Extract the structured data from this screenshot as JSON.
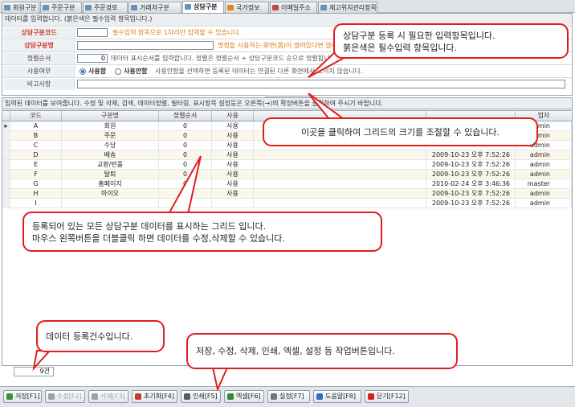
{
  "tabs": [
    {
      "label": "회원구분",
      "active": false
    },
    {
      "label": "주문구분",
      "active": false
    },
    {
      "label": "주문경로",
      "active": false
    },
    {
      "label": "거래처구분",
      "active": false
    },
    {
      "label": "상담구분",
      "active": true
    },
    {
      "label": "국가정보",
      "active": false
    },
    {
      "label": "이메일주소",
      "active": false
    },
    {
      "label": "재고위치관리항목",
      "active": false
    }
  ],
  "form": {
    "header": "데이터를 입력합니다. (붉은색은 필수입력 항목입니다.)",
    "code_label": "상담구분코드",
    "code_hint": "필수입력 항목으로 1자리만 입력할 수 있습니다.",
    "name_label": "상담구분명",
    "name_hint": "명청을 사용하는 화면(폼)이 열려있다면 열려있는 화면을 다시",
    "sort_label": "정렬순서",
    "sort_value": "0",
    "sort_hint": "데이터 표시순서를 입력합니다. 정렬은 정렬순서 + 상담구분코드 순으로 정렬됩니다.",
    "use_label": "사용여부",
    "use_yes": "사용함",
    "use_no": "사용안함",
    "use_hint": "사용안함을 선택하면 등록된 데이터는 연결된 다른 화면에서 보이지 않습니다.",
    "note_label": "비고사항"
  },
  "grid": {
    "info": "입력된 데이터를 보여줍니다. 수정 및 삭제, 검색, 데이터정렬, 필터링, 표시항목 설정등은 오른쪽(→)의 확장버튼을 클릭하여 주시기 바랍니다.",
    "columns": [
      "코드",
      "구분명",
      "정렬순서",
      "사용",
      "",
      "",
      "업자"
    ],
    "rows": [
      {
        "code": "A",
        "name": "회원",
        "sort": "0",
        "use": "사용",
        "date": "",
        "user": "admin"
      },
      {
        "code": "B",
        "name": "주문",
        "sort": "0",
        "use": "사용",
        "date": "",
        "user": "admin"
      },
      {
        "code": "C",
        "name": "수당",
        "sort": "0",
        "use": "사용",
        "date": "",
        "user": "admin"
      },
      {
        "code": "D",
        "name": "배송",
        "sort": "0",
        "use": "사용",
        "date": "2009-10-23 오후 7:52:26",
        "user": "admin"
      },
      {
        "code": "E",
        "name": "교환/반품",
        "sort": "0",
        "use": "사용",
        "date": "2009-10-23 오후 7:52:26",
        "user": "admin"
      },
      {
        "code": "F",
        "name": "탈퇴",
        "sort": "0",
        "use": "사용",
        "date": "2009-10-23 오후 7:52:26",
        "user": "admin"
      },
      {
        "code": "G",
        "name": "홈페이지",
        "sort": "0",
        "use": "사용",
        "date": "2010-02-24 오후 3:46:36",
        "user": "master"
      },
      {
        "code": "H",
        "name": "마이오",
        "sort": "0",
        "use": "사용",
        "date": "2009-10-23 오후 7:52:26",
        "user": "admin"
      },
      {
        "code": "I",
        "name": "",
        "sort": "",
        "use": "",
        "date": "2009-10-23 오후 7:52:26",
        "user": "admin"
      }
    ]
  },
  "count": "9건",
  "toolbar": [
    {
      "label": "저장[F1]",
      "icon": "save-icon",
      "disabled": false,
      "color": "#3f8f3f"
    },
    {
      "label": "수정[F2]",
      "icon": "edit-icon",
      "disabled": true,
      "color": "#9aa3ac"
    },
    {
      "label": "삭제[F3]",
      "icon": "delete-icon",
      "disabled": true,
      "color": "#9aa3ac"
    },
    {
      "label": "초기화[F4]",
      "icon": "reset-icon",
      "disabled": false,
      "color": "#c33b2a"
    },
    {
      "label": "인쇄[F5]",
      "icon": "print-icon",
      "disabled": false,
      "color": "#555f69"
    },
    {
      "label": "엑셀[F6]",
      "icon": "excel-icon",
      "disabled": false,
      "color": "#2e8b3a"
    },
    {
      "label": "설정[F7]",
      "icon": "settings-icon",
      "disabled": false,
      "color": "#6b7785"
    },
    {
      "label": "도움말[F8]",
      "icon": "help-icon",
      "disabled": false,
      "color": "#2f6fc0"
    },
    {
      "label": "닫기[F12]",
      "icon": "close-icon",
      "disabled": false,
      "color": "#d42020"
    }
  ],
  "callouts": {
    "input": "상담구분 등록 시 필요한 입력항목입니다.\n붉은색은 필수입력 항목입니다.",
    "resize": "이곳을 클릭하여 그리드의 크기를 조절할 수 있습니다.",
    "grid": "등록되어 있는 모든 상담구분 데이터를 표시하는 그리드 입니다.\n마우스 왼쪽버튼을 더블클릭 하면 데이터를 수정,삭제할 수 있습니다.",
    "count": "데이터 등록건수입니다.",
    "toolbar": "저장, 수정, 삭제, 인쇄, 엑셀, 설정 등 작업버튼입니다."
  }
}
